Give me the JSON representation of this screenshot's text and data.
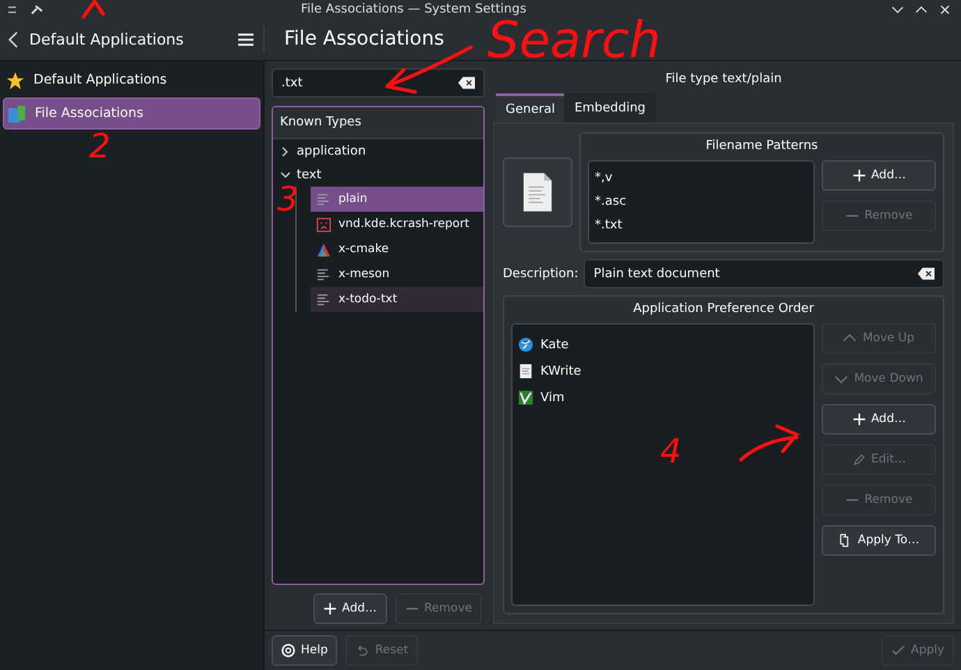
{
  "window": {
    "title": "File Associations — System Settings"
  },
  "header": {
    "back_title": "Default Applications",
    "page_title": "File Associations"
  },
  "sidebar": {
    "items": [
      {
        "label": "Default Applications",
        "kind": "star",
        "selected": false
      },
      {
        "label": "File Associations",
        "kind": "files",
        "selected": true
      }
    ]
  },
  "search": {
    "value": ".txt"
  },
  "known_types": {
    "title": "Known Types",
    "tree": [
      {
        "label": "application",
        "expanded": false
      },
      {
        "label": "text",
        "expanded": true,
        "children": [
          {
            "label": "plain",
            "kind": "text",
            "selected": true,
            "hovered": false
          },
          {
            "label": "vnd.kde.kcrash-report",
            "kind": "crash",
            "selected": false,
            "hovered": false
          },
          {
            "label": "x-cmake",
            "kind": "cmake",
            "selected": false,
            "hovered": false
          },
          {
            "label": "x-meson",
            "kind": "text",
            "selected": false,
            "hovered": false
          },
          {
            "label": "x-todo-txt",
            "kind": "text",
            "selected": false,
            "hovered": true
          }
        ]
      }
    ]
  },
  "type_buttons": [
    {
      "label": "Add…",
      "kind": "plus",
      "disabled": false
    },
    {
      "label": "Remove",
      "kind": "minus",
      "disabled": true
    }
  ],
  "details": {
    "heading": "File type text/plain",
    "tabs": [
      {
        "label": "General",
        "selected": true
      },
      {
        "label": "Embedding",
        "selected": false
      }
    ],
    "filename_patterns": {
      "title": "Filename Patterns",
      "patterns": [
        "*,v",
        "*.asc",
        "*.txt"
      ],
      "buttons": [
        {
          "label": "Add…",
          "kind": "plus",
          "disabled": false
        },
        {
          "label": "Remove",
          "kind": "minus",
          "disabled": true
        }
      ]
    },
    "description": {
      "label": "Description:",
      "value": "Plain text document"
    },
    "app_order": {
      "title": "Application Preference Order",
      "apps": [
        {
          "label": "Kate",
          "kind": "kate"
        },
        {
          "label": "KWrite",
          "kind": "kwrite"
        },
        {
          "label": "Vim",
          "kind": "vim"
        }
      ],
      "buttons": [
        {
          "label": "Move Up",
          "kind": "up",
          "disabled": true
        },
        {
          "label": "Move Down",
          "kind": "down",
          "disabled": true
        },
        {
          "label": "Add…",
          "kind": "plus",
          "disabled": false
        },
        {
          "label": "Edit…",
          "kind": "pencil",
          "disabled": true
        },
        {
          "label": "Remove",
          "kind": "minus",
          "disabled": true
        },
        {
          "label": "Apply To…",
          "kind": "copy",
          "disabled": false
        }
      ]
    }
  },
  "footer": {
    "buttons": [
      {
        "label": "Help",
        "kind": "help",
        "disabled": false
      },
      {
        "label": "Reset",
        "kind": "undo",
        "disabled": true
      },
      {
        "label": "Apply",
        "kind": "check",
        "disabled": true
      }
    ]
  },
  "annotations": [
    {
      "kind": "caret"
    },
    {
      "kind": "text",
      "text": "Search"
    },
    {
      "kind": "arrow"
    },
    {
      "kind": "text",
      "text": "2"
    },
    {
      "kind": "text",
      "text": "3"
    },
    {
      "kind": "text",
      "text": "4"
    },
    {
      "kind": "arrow"
    }
  ]
}
